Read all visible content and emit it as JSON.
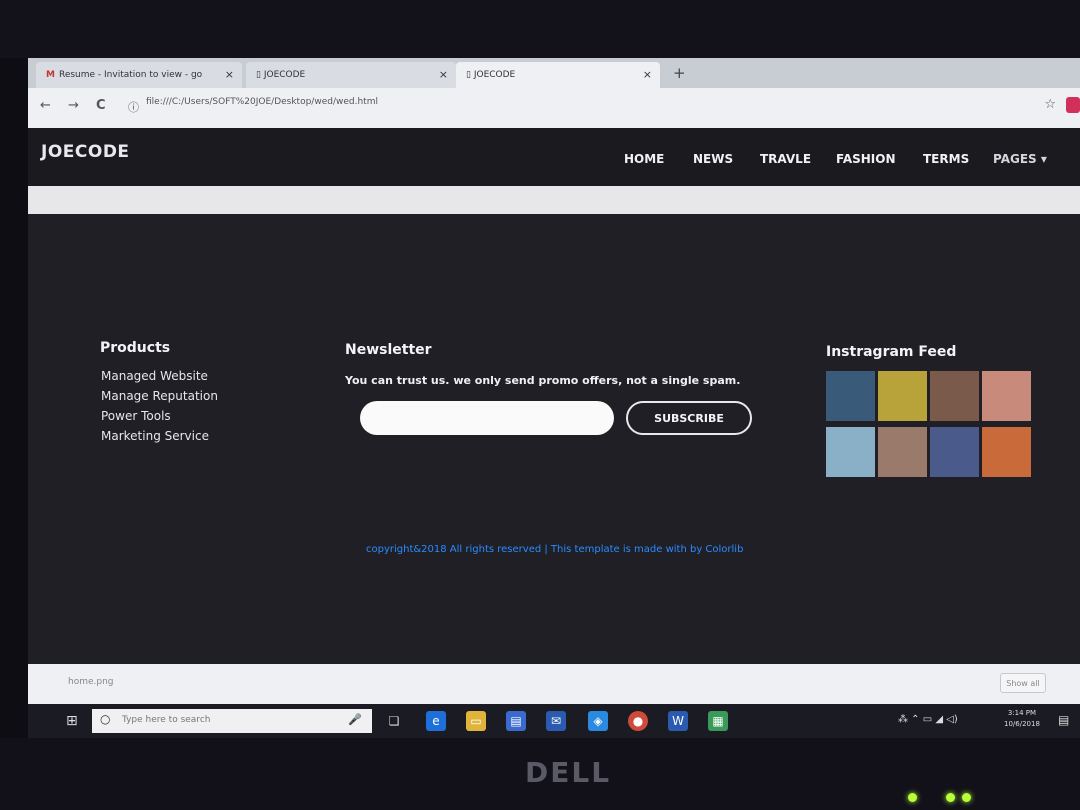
{
  "browser": {
    "tabs": [
      {
        "label": "Resume - Invitation to view - go",
        "close": "×"
      },
      {
        "label": "JOECODE",
        "close": "×"
      },
      {
        "label": "JOECODE",
        "close": "×"
      }
    ],
    "new_tab": "+",
    "back": "←",
    "forward": "→",
    "reload": "C",
    "url": "file:///C:/Users/SOFT%20JOE/Desktop/wed/wed.html",
    "bookmark": "☆"
  },
  "site": {
    "brand": "JOECODE",
    "nav": [
      "HOME",
      "NEWS",
      "TRAVLE",
      "FASHION",
      "TERMS",
      "PAGES ▾"
    ],
    "products": {
      "title": "Products",
      "links": [
        "Managed Website",
        "Manage Reputation",
        "Power Tools",
        "Marketing Service"
      ]
    },
    "newsletter": {
      "title": "Newsletter",
      "text": "You can trust us. we only send promo offers, not a single spam.",
      "email_placeholder": "",
      "subscribe_label": "SUBSCRIBE"
    },
    "instagram": {
      "title": "Instragram Feed",
      "colors": [
        "#3a5a7a",
        "#b8a23a",
        "#7a5a4a",
        "#c88a7a",
        "#8ab0c8",
        "#9a7a6a",
        "#4a5a8a",
        "#c86a3a"
      ]
    },
    "copyright": "copyright&2018 All rights reserved | This template is made with by Colorlib"
  },
  "download_shelf": {
    "file": "home.png",
    "show_all": "Show all"
  },
  "taskbar": {
    "search_placeholder": "Type here to search",
    "time": "3:14 PM",
    "date": "10/6/2018"
  },
  "hardware": {
    "logo": "DELL"
  }
}
